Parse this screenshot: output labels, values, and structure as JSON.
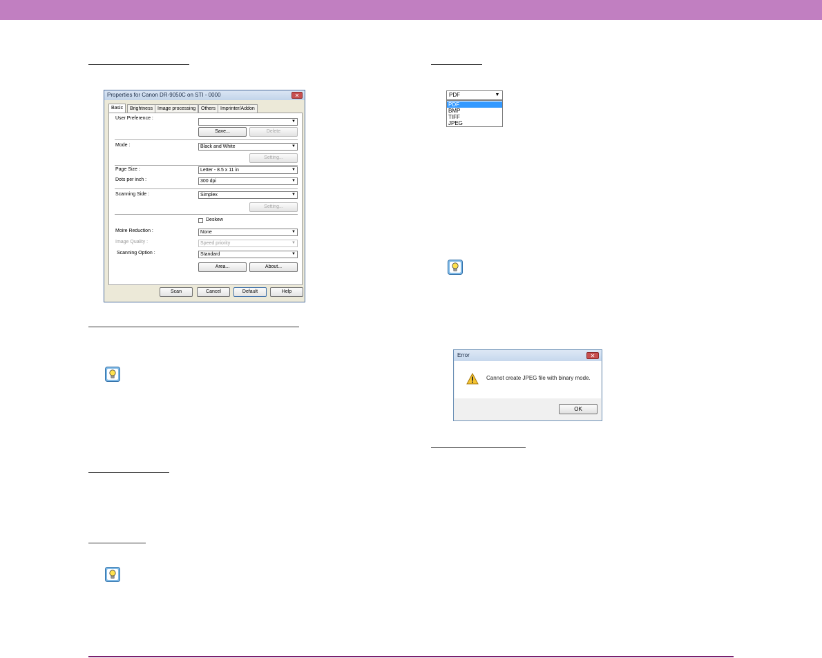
{
  "colors": {
    "accent_purple": "#c17fc1",
    "rule_purple": "#7a1f6e",
    "selection_blue": "#3399ff"
  },
  "properties_dialog": {
    "title": "Properties for Canon DR-9050C on STI - 0000",
    "close_glyph": "✕",
    "tabs": [
      "Basic",
      "Brightness",
      "Image processing",
      "Others",
      "Imprinter/Addon"
    ],
    "labels": {
      "user_preference": "User Preference :",
      "mode": "Mode :",
      "page_size": "Page Size :",
      "dots_per_inch": "Dots per inch :",
      "scanning_side": "Scanning Side :",
      "moire_reduction": "Moire Reduction :",
      "image_quality": "Image Quality :",
      "scanning_option": "Scanning Option :",
      "deskew": "Deskew"
    },
    "values": {
      "user_preference": "",
      "mode": "Black and White",
      "page_size": "Letter - 8.5 x 11 in",
      "dots_per_inch": "300 dpi",
      "scanning_side": "Simplex",
      "moire_reduction": "None",
      "image_quality": "Speed priority",
      "scanning_option": "Standard"
    },
    "buttons": {
      "save": "Save...",
      "delete": "Delete",
      "setting": "Setting...",
      "area": "Area...",
      "about": "About...",
      "scan": "Scan",
      "cancel": "Cancel",
      "default": "Default",
      "help": "Help"
    },
    "dropdown_arrow": "▼"
  },
  "file_format": {
    "selected": "PDF",
    "options": [
      "PDF",
      "BMP",
      "TIFF",
      "JPEG"
    ],
    "dropdown_arrow": "▼"
  },
  "error_dialog": {
    "title": "Error",
    "close_glyph": "✕",
    "message": "Cannot create JPEG file with binary mode.",
    "ok_label": "OK"
  },
  "icons": {
    "hint": "lightbulb-hint-icon",
    "warning": "warning-triangle-icon"
  }
}
